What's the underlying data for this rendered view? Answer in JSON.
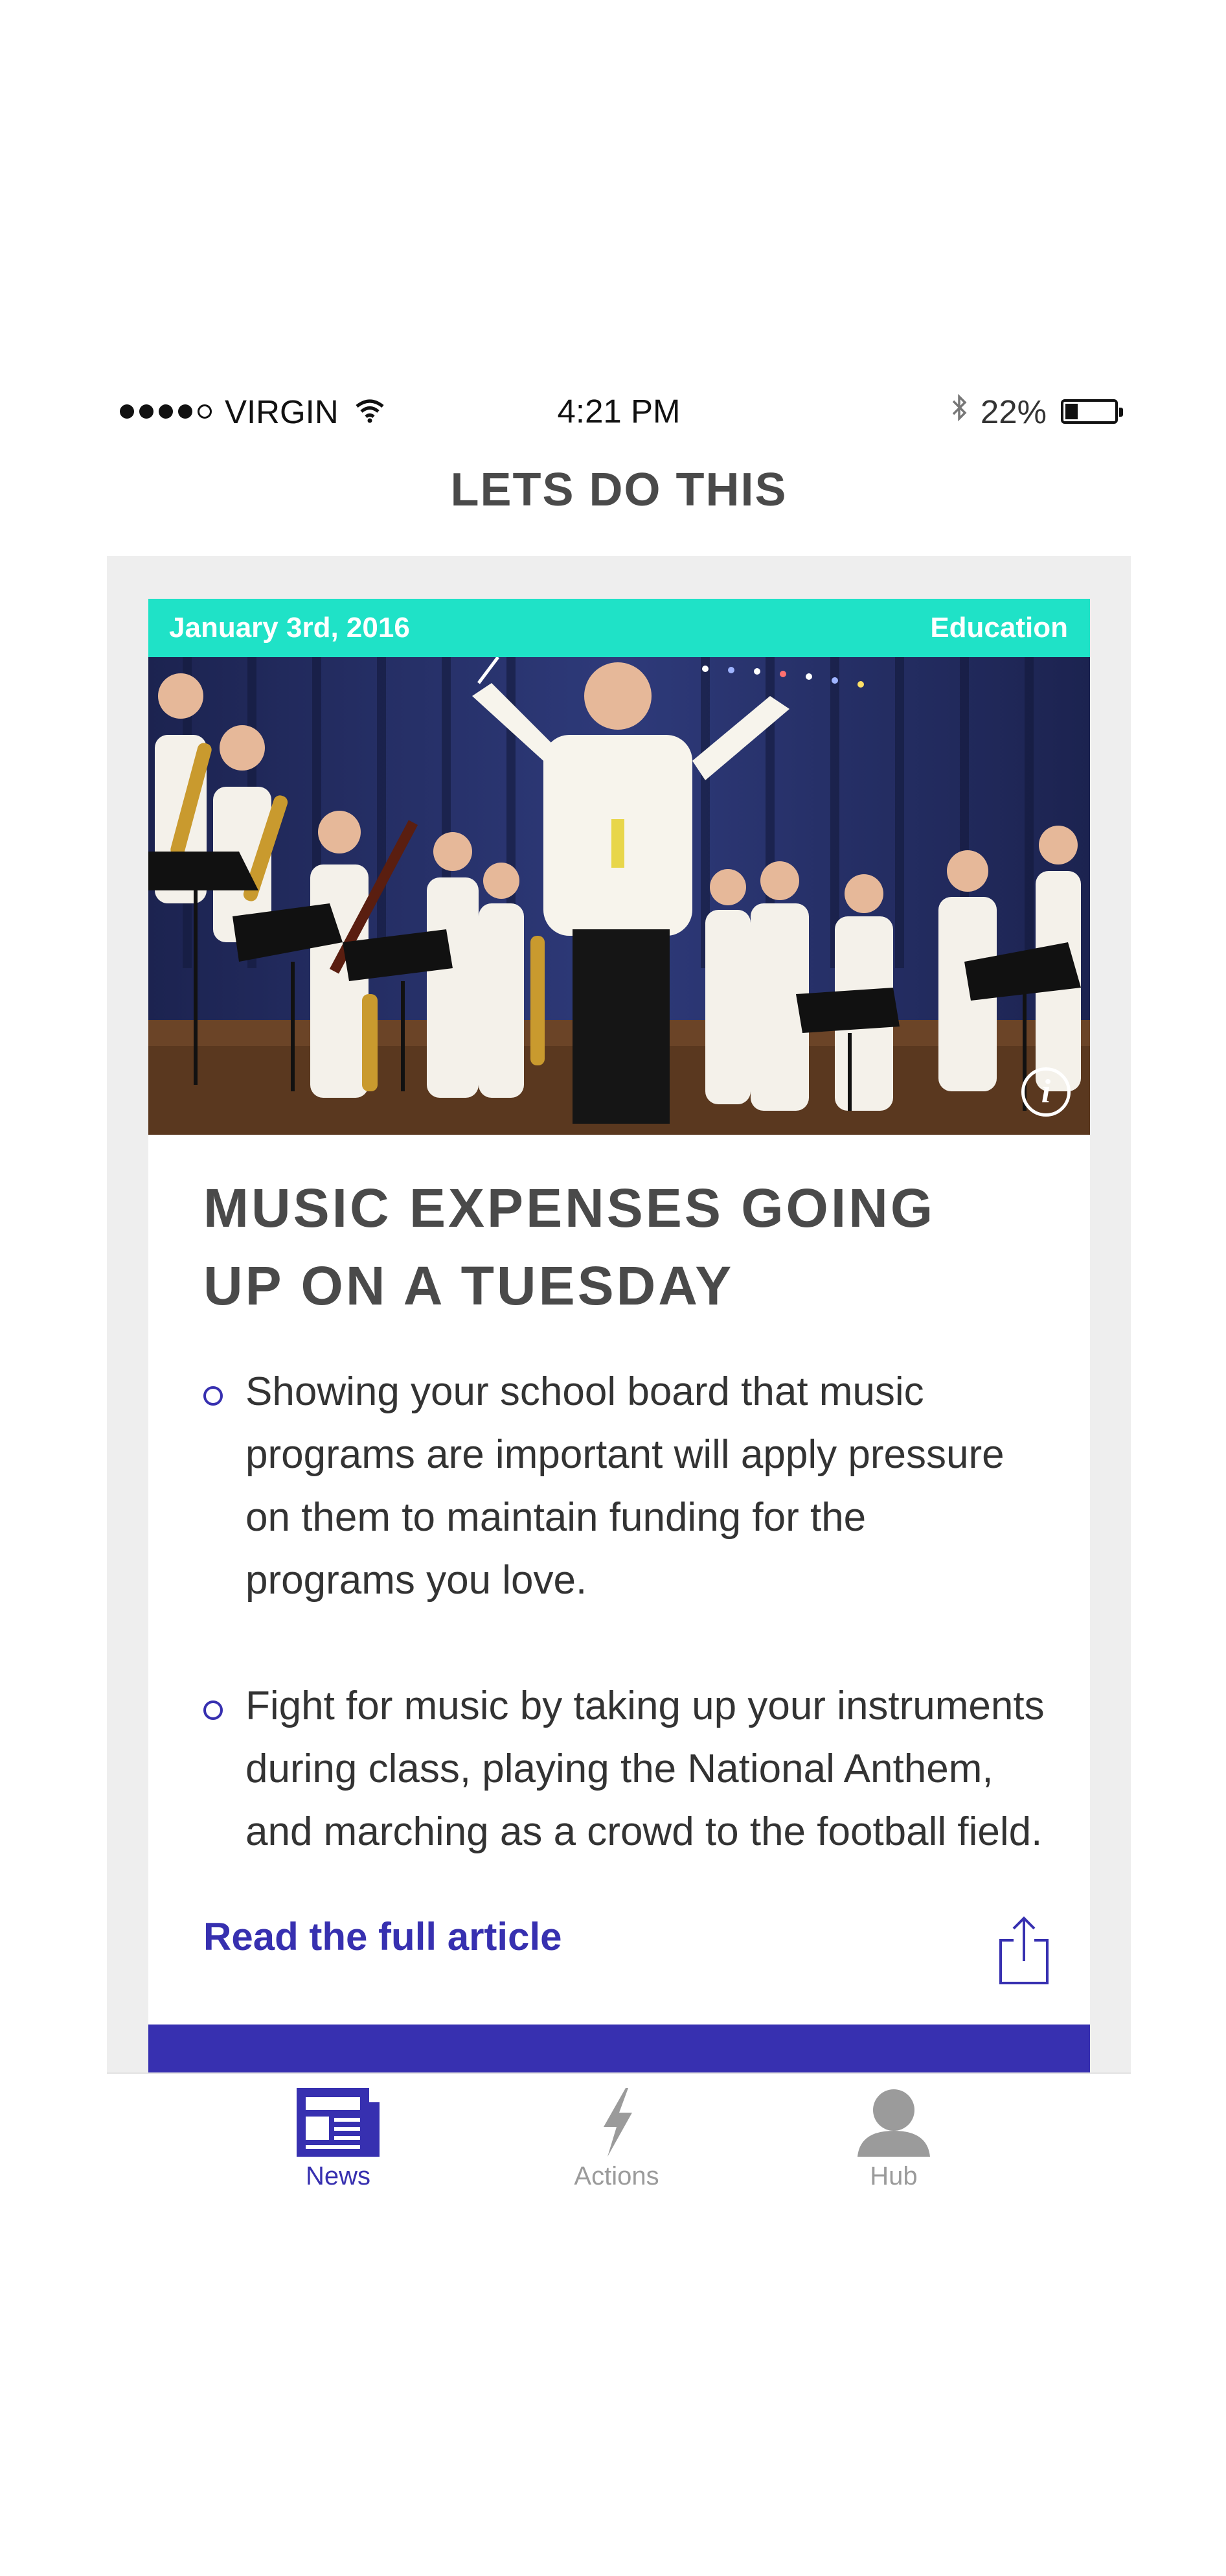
{
  "status_bar": {
    "carrier": "VIRGIN",
    "signal_bars": 4,
    "signal_total": 5,
    "time": "4:21 PM",
    "battery": "22%",
    "battery_level": 0.22
  },
  "nav": {
    "title": "LETS DO THIS"
  },
  "card": {
    "date": "January 3rd, 2016",
    "category": "Education",
    "headline": "MUSIC EXPENSES GOING UP ON A TUESDAY",
    "bullets": [
      "Showing your school board that music programs are important will apply pressure on them to maintain funding for the programs you love.",
      "Fight for music by taking up your instruments during class, playing the National Anthem, and marching as a crowd to the football field."
    ],
    "read_more": "Read the full article"
  },
  "tabs": [
    {
      "label": "News",
      "icon": "newspaper-icon",
      "active": true
    },
    {
      "label": "Actions",
      "icon": "lightning-icon",
      "active": false
    },
    {
      "label": "Hub",
      "icon": "person-icon",
      "active": false
    }
  ],
  "colors": {
    "accent": "#3730b0",
    "header_teal": "#1fe2c7",
    "inactive": "#9b9b9b"
  }
}
